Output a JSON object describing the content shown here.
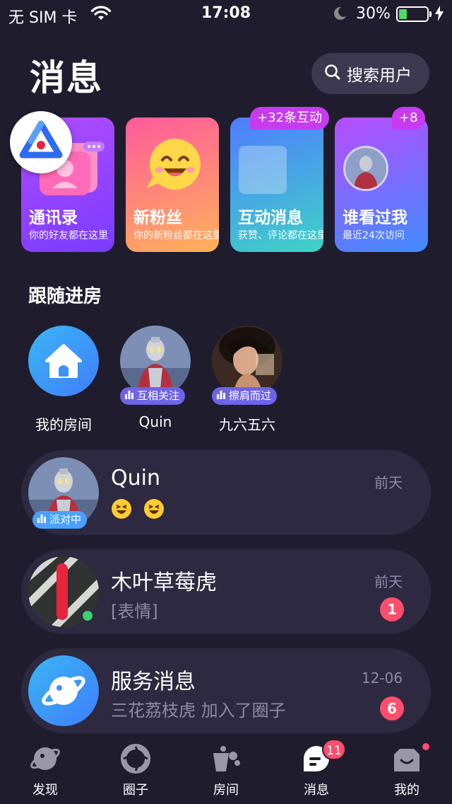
{
  "status_bar": {
    "carrier": "无 SIM 卡",
    "time": "17:08",
    "battery_percent": "30%",
    "battery_level": 0.3
  },
  "header": {
    "title": "消息",
    "search_label": "搜索用户"
  },
  "cards": [
    {
      "title": "通讯录",
      "subtitle": "你的好友都在这里"
    },
    {
      "title": "新粉丝",
      "subtitle": "你的新粉丝都在这里"
    },
    {
      "title": "互动消息",
      "subtitle": "获赞、评论都在这里",
      "badge": "+32条互动"
    },
    {
      "title": "谁看过我",
      "subtitle": "最近24次访问",
      "badge": "+8"
    }
  ],
  "follow_section": {
    "title": "跟随进房",
    "items": [
      {
        "name": "我的房间"
      },
      {
        "name": "Quin",
        "tag": "互相关注"
      },
      {
        "name": "九六五六",
        "tag": "擦肩而过"
      }
    ]
  },
  "chats": [
    {
      "name": "Quin",
      "time": "前天",
      "tag": "派对中"
    },
    {
      "name": "木叶草莓虎",
      "message": "[表情]",
      "time": "前天",
      "unread": "1"
    },
    {
      "name": "服务消息",
      "message": "三花荔枝虎 加入了圈子",
      "time": "12-06",
      "unread": "6"
    }
  ],
  "tab_bar": {
    "tabs": [
      {
        "label": "发现",
        "icon": "planet-icon"
      },
      {
        "label": "圈子",
        "icon": "circle-icon"
      },
      {
        "label": "房间",
        "icon": "room-icon"
      },
      {
        "label": "消息",
        "icon": "message-icon",
        "badge": "11",
        "active": true
      },
      {
        "label": "我的",
        "icon": "profile-icon"
      }
    ]
  },
  "colors": {
    "background": "#1f1c2e",
    "accent_badge": "#ff4d6d",
    "secondary_text": "#8e8aa8"
  }
}
